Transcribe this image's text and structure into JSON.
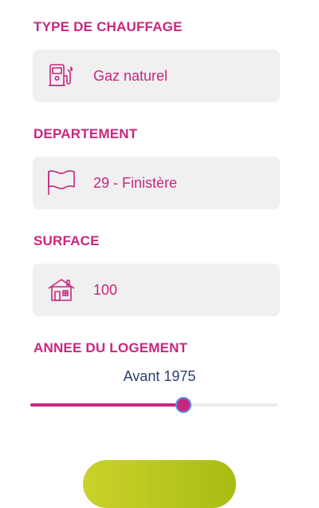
{
  "form": {
    "heating_type": {
      "label": "TYPE DE CHAUFFAGE",
      "value": "Gaz naturel",
      "icon": "fuel-pump-icon"
    },
    "department": {
      "label": "DEPARTEMENT",
      "value": "29 - Finistère",
      "icon": "flag-icon"
    },
    "surface": {
      "label": "SURFACE",
      "value": "100",
      "icon": "house-icon"
    },
    "year": {
      "label": "ANNEE DU LOGEMENT",
      "value": "Avant 1975",
      "slider_fraction": 0.62
    }
  },
  "colors": {
    "accent": "#c8267f",
    "field_bg": "#f0f0f0",
    "slider_value_text": "#2a3f6e",
    "button_green": "#b5c61d"
  }
}
